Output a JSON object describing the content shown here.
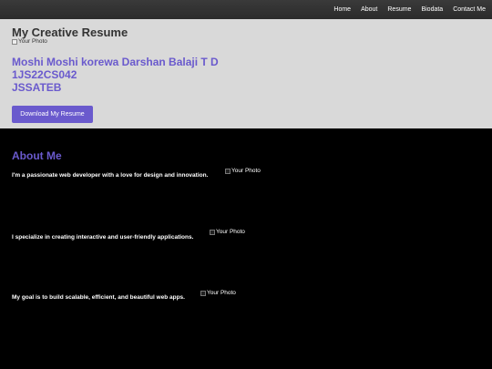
{
  "nav": {
    "items": [
      "Home",
      "About",
      "Resume",
      "Biodata",
      "Contact Me"
    ]
  },
  "hero": {
    "title": "My Creative Resume",
    "photo_alt": "Your Photo",
    "name": "Moshi Moshi korewa Darshan Balaji T D",
    "usn": "1JS22CS042",
    "college": "JSSATEB",
    "download_label": "Download My Resume"
  },
  "about": {
    "title": "About Me",
    "paragraphs": [
      "I'm a passionate web developer with a love for design and innovation.",
      "I specialize in creating interactive and user-friendly applications.",
      "My goal is to build scalable, efficient, and beautiful web apps."
    ],
    "photo_alt": "Your Photo"
  },
  "colors": {
    "accent": "#6a5acd",
    "hero_bg": "#d9d9d9",
    "nav_bg": "#333333",
    "page_bg": "#000000"
  }
}
